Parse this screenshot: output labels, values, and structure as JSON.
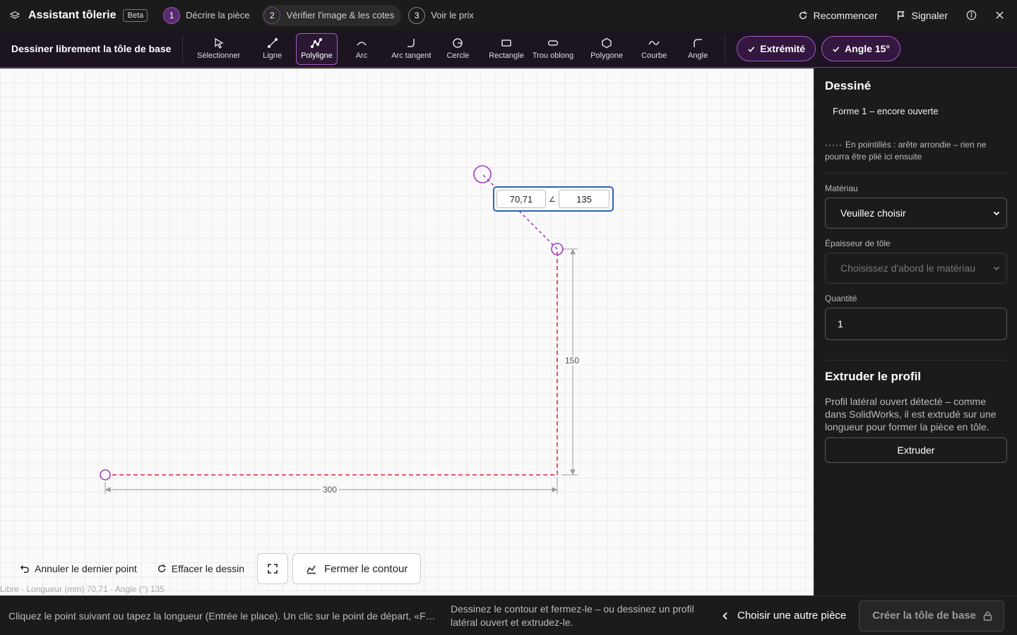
{
  "app": {
    "title": "Assistant tôlerie",
    "badge": "Beta"
  },
  "steps": [
    {
      "num": "1",
      "label": "Décrire la pièce"
    },
    {
      "num": "2",
      "label": "Vérifier l'image & les cotes"
    },
    {
      "num": "3",
      "label": "Voir le prix"
    }
  ],
  "top_actions": {
    "restart": "Recommencer",
    "report": "Signaler"
  },
  "toolbar": {
    "title": "Dessiner librement la tôle de base",
    "tools": [
      "Sélectionner",
      "Ligne",
      "Polyligne",
      "Arc",
      "Arc tangent",
      "Cercle",
      "Rectangle",
      "Trou oblong",
      "Polygone",
      "Courbe",
      "Angle"
    ],
    "active_tool": "Polyligne",
    "snap_endpoint": "Extrémité",
    "snap_angle": "Angle 15°"
  },
  "canvas": {
    "dim_horizontal": "300",
    "dim_vertical": "150",
    "length_value": "70,71",
    "angle_symbol": "∠",
    "angle_value": "135",
    "status": "Libre · Longueur (mm) 70,71 · Angle (°) 135",
    "actions": {
      "undo": "Annuler le dernier point",
      "clear": "Effacer le dessin",
      "close": "Fermer le contour"
    }
  },
  "panel": {
    "drawn_title": "Dessiné",
    "shape": "Forme 1 – encore ouverte",
    "hint_dots": "·····",
    "hint": "En pointillés : arête arrondie – rien ne pourra être plié ici ensuite",
    "material_label": "Matériau",
    "material_value": "Veuillez choisir",
    "thickness_label": "Épaisseur de tôle",
    "thickness_value": "Choisissez d'abord le matériau",
    "quantity_label": "Quantité",
    "quantity_value": "1",
    "extrude_title": "Extruder le profil",
    "extrude_text": "Profil latéral ouvert détecté – comme dans SolidWorks, il est extrudé sur une longueur pour former la pièce en tôle.",
    "extrude_button": "Extruder"
  },
  "bottom": {
    "hint": "Cliquez le point suivant ou tapez la longueur (Entrée le place). Un clic sur le point de départ, «Fermer le contour»",
    "info": "Dessinez le contour et fermez-le – ou dessinez un profil latéral ouvert et extrudez-le.",
    "back": "Choisir une autre pièce",
    "create": "Créer la tôle de base"
  },
  "colors": {
    "accent": "#a55bc4",
    "line": "#e8405a",
    "input_border": "#2f5ec4"
  }
}
